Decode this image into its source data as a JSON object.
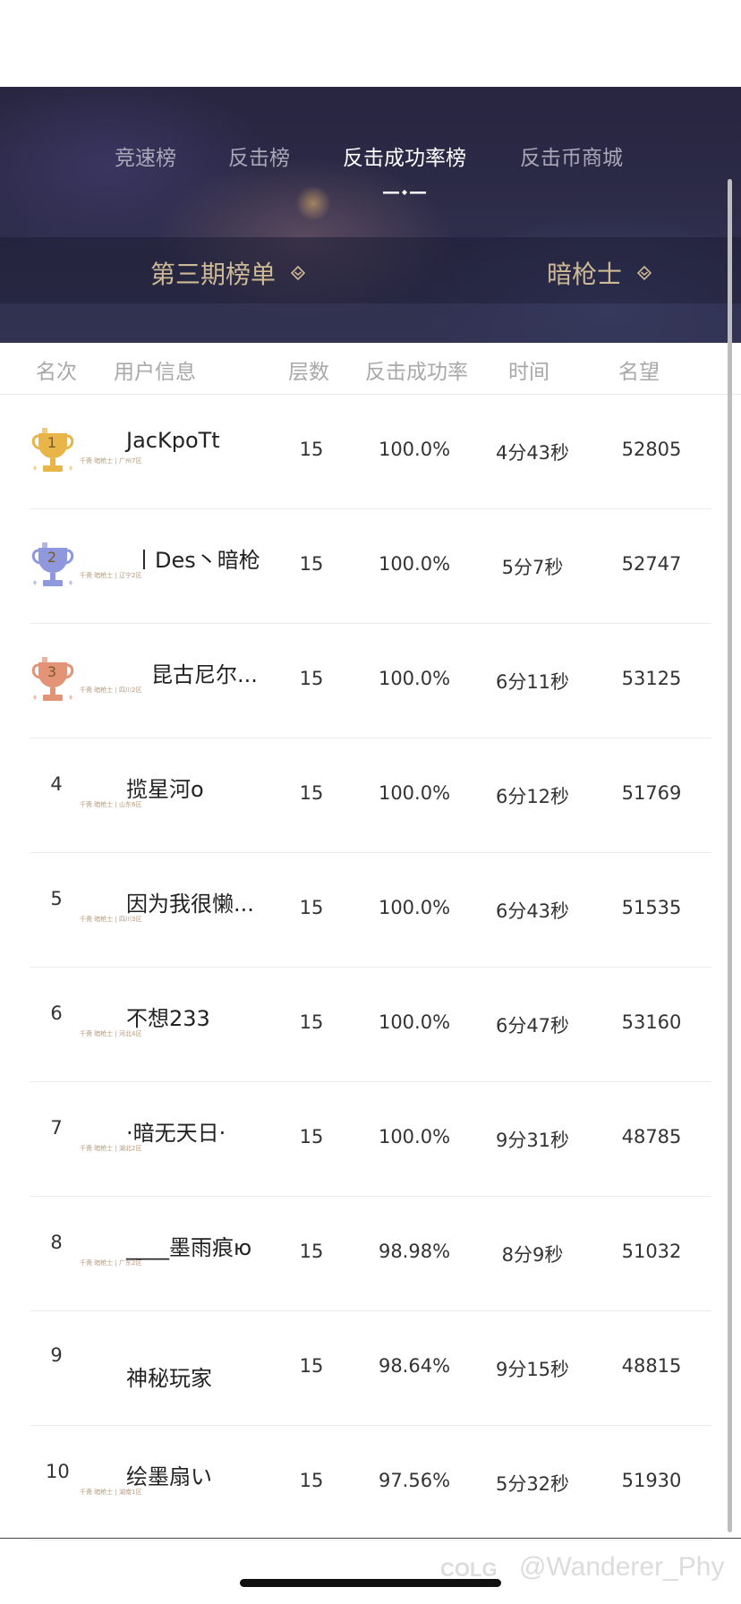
{
  "tabs": [
    "竞速榜",
    "反击榜",
    "反击成功率榜",
    "反击币商城"
  ],
  "active_tab_index": 2,
  "filters": {
    "period": "第三期榜单",
    "class": "暗枪士"
  },
  "columns": [
    "名次",
    "用户信息",
    "层数",
    "反击成功率",
    "时间",
    "名望"
  ],
  "rows": [
    {
      "rank": "1",
      "trophy": "gold",
      "name": "JacKpoTt",
      "sub": "千斋 暗枪士 | 广州7区",
      "floors": "15",
      "rate": "100.0%",
      "time": "4分43秒",
      "fame": "52805"
    },
    {
      "rank": "2",
      "trophy": "silver",
      "name": "丨Des丶暗枪",
      "sub": "千斋 暗枪士 | 辽宁2区",
      "floors": "15",
      "rate": "100.0%",
      "time": "5分7秒",
      "fame": "52747"
    },
    {
      "rank": "3",
      "trophy": "bronze",
      "name": "昆古尼尔...",
      "sub": "千斋 暗枪士 | 四川2区",
      "floors": "15",
      "rate": "100.0%",
      "time": "6分11秒",
      "fame": "53125"
    },
    {
      "rank": "4",
      "trophy": "",
      "name": "揽星河o",
      "sub": "千斋 暗枪士 | 山东6区",
      "floors": "15",
      "rate": "100.0%",
      "time": "6分12秒",
      "fame": "51769"
    },
    {
      "rank": "5",
      "trophy": "",
      "name": "因为我很懒...",
      "sub": "千斋 暗枪士 | 四川3区",
      "floors": "15",
      "rate": "100.0%",
      "time": "6分43秒",
      "fame": "51535"
    },
    {
      "rank": "6",
      "trophy": "",
      "name": "不想233",
      "sub": "千斋 暗枪士 | 河北4区",
      "floors": "15",
      "rate": "100.0%",
      "time": "6分47秒",
      "fame": "53160"
    },
    {
      "rank": "7",
      "trophy": "",
      "name": "·暗无天日·",
      "sub": "千斋 暗枪士 | 湖北2区",
      "floors": "15",
      "rate": "100.0%",
      "time": "9分31秒",
      "fame": "48785"
    },
    {
      "rank": "8",
      "trophy": "",
      "name": "____墨雨痕ю",
      "sub": "千斋 暗枪士 | 广东2区",
      "floors": "15",
      "rate": "98.98%",
      "time": "8分9秒",
      "fame": "51032"
    },
    {
      "rank": "9",
      "trophy": "",
      "name": "神秘玩家",
      "sub": "",
      "floors": "15",
      "rate": "98.64%",
      "time": "9分15秒",
      "fame": "48815"
    },
    {
      "rank": "10",
      "trophy": "",
      "name": "绘墨扇い",
      "sub": "千斋 暗枪士 | 湖南1区",
      "floors": "15",
      "rate": "97.56%",
      "time": "5分32秒",
      "fame": "51930"
    }
  ],
  "trophy_colors": {
    "gold": "#e8b548",
    "silver": "#8f97dd",
    "bronze": "#e39477"
  },
  "watermark": "@Wanderer_Phy",
  "watermark_logo": "COLG"
}
